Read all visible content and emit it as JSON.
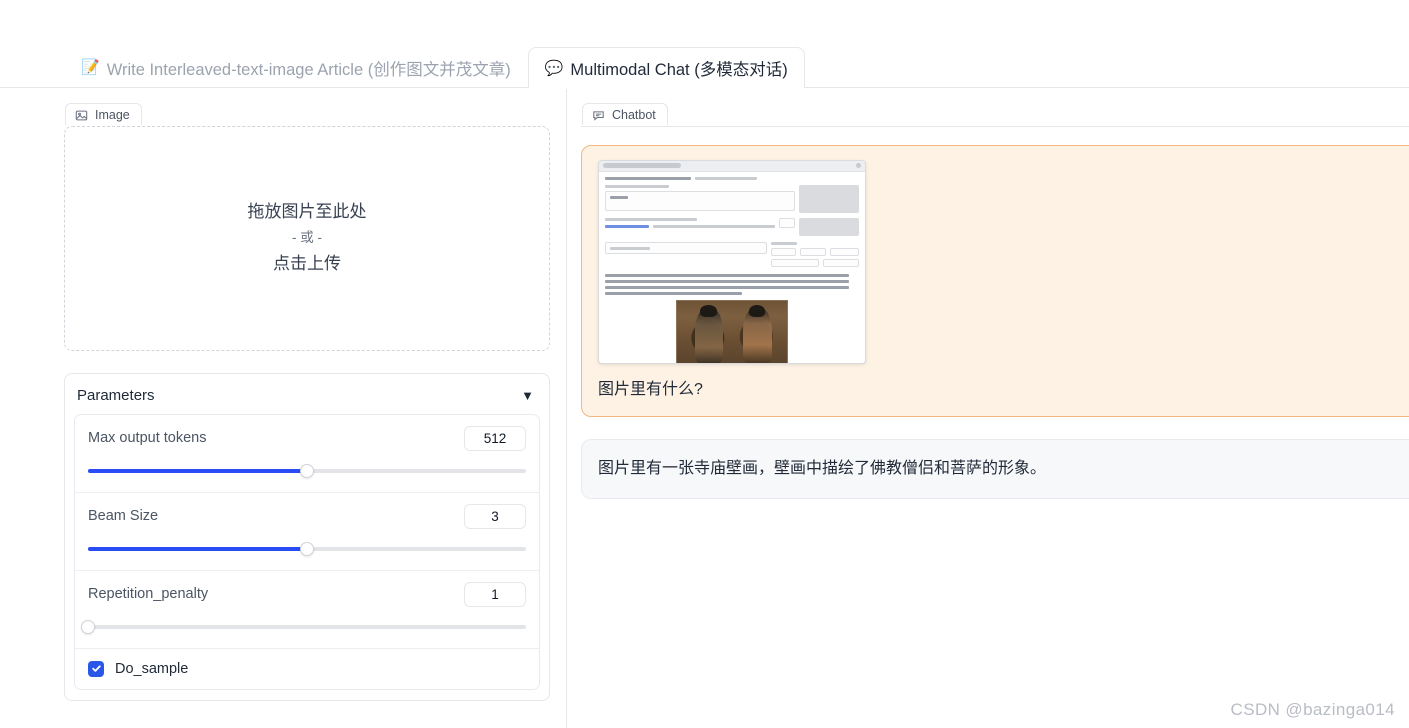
{
  "tabs": [
    {
      "icon": "📝",
      "icon_name": "memo-icon",
      "label": "Write Interleaved-text-image Article (创作图文并茂文章)",
      "active": false
    },
    {
      "icon": "💬",
      "icon_name": "speech-bubble-icon",
      "label": "Multimodal Chat (多模态对话)",
      "active": true
    }
  ],
  "left_panel": {
    "image_block": {
      "label": "Image",
      "icon_name": "picture-icon",
      "drop_primary": "拖放图片至此处",
      "drop_or": "- 或 -",
      "drop_upload": "点击上传"
    },
    "parameters": {
      "title": "Parameters",
      "collapse_icon": "▼",
      "rows": [
        {
          "label": "Max output tokens",
          "value": "512",
          "fill_percent": 50
        },
        {
          "label": "Beam Size",
          "value": "3",
          "fill_percent": 50
        },
        {
          "label": "Repetition_penalty",
          "value": "1",
          "fill_percent": 0
        }
      ],
      "checkbox": {
        "label": "Do_sample",
        "checked": true
      }
    }
  },
  "right_panel": {
    "chatbot_label": "Chatbot",
    "chatbot_icon_name": "chat-icon",
    "messages": [
      {
        "role": "user",
        "has_image": true,
        "text": "图片里有什么?"
      },
      {
        "role": "bot",
        "has_image": false,
        "text": "图片里有一张寺庙壁画，壁画中描绘了佛教僧侣和菩萨的形象。"
      }
    ]
  },
  "watermark": "CSDN @bazinga014",
  "colors": {
    "accent_blue": "#2a4cf4",
    "checkbox_blue": "#2a57e8",
    "user_bubble_bg": "#fdf2e4",
    "user_bubble_border": "#f2b880",
    "bot_bubble_bg": "#f7f8fa",
    "bot_bubble_border": "#e9ebef",
    "border_gray": "#e5e7eb",
    "text_dark": "#1f2937",
    "text_muted": "#9ca3af"
  }
}
